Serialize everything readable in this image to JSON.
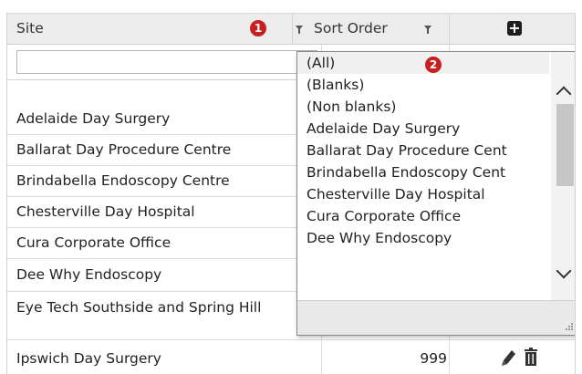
{
  "header": {
    "site_label": "Site",
    "sort_order_label": "Sort Order",
    "badge_1": "1",
    "badge_2": "2",
    "add_symbol": "+"
  },
  "filter": {
    "value": "",
    "placeholder": ""
  },
  "rows": [
    {
      "site": "Adelaide Day Surgery",
      "order": ""
    },
    {
      "site": "Ballarat Day Procedure Centre",
      "order": ""
    },
    {
      "site": "Brindabella Endoscopy Centre",
      "order": ""
    },
    {
      "site": "Chesterville Day Hospital",
      "order": ""
    },
    {
      "site": "Cura Corporate Office",
      "order": ""
    },
    {
      "site": "Dee Why Endoscopy",
      "order": ""
    },
    {
      "site": "Eye Tech Southside and Spring Hill",
      "order": ""
    },
    {
      "site": "Ipswich Day Surgery",
      "order": "999"
    }
  ],
  "dropdown": {
    "selected": "(All)",
    "items": [
      "(All)",
      "(Blanks)",
      "(Non blanks)",
      "Adelaide Day Surgery",
      "Ballarat Day Procedure Cent",
      "Brindabella Endoscopy Cent",
      "Chesterville Day Hospital",
      "Cura Corporate Office",
      "Dee Why Endoscopy"
    ]
  },
  "icons": {
    "filter": "filter-icon",
    "add": "plus-square-icon",
    "edit": "pencil-icon",
    "delete": "trash-icon",
    "scroll_up": "chevron-up-icon",
    "scroll_down": "chevron-down-icon",
    "resize": "resize-grip-icon"
  },
  "colors": {
    "badge": "#c62020",
    "header_bg": "#ececec",
    "scroll_thumb": "#c6c6c6"
  }
}
